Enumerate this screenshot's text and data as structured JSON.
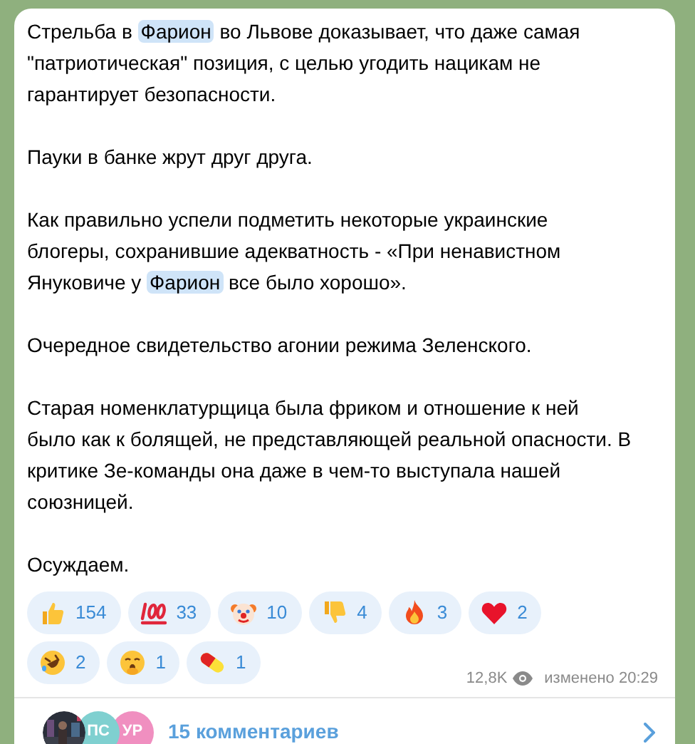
{
  "post": {
    "paragraphs": [
      [
        {
          "text": "Стрельба в ",
          "highlighted": false
        },
        {
          "text": "Фарион",
          "highlighted": true
        },
        {
          "text": " во Львове доказывает, что даже самая \"патриотическая\" позиция, с целью угодить нацикам не гарантирует безопасности.",
          "highlighted": false
        }
      ],
      [
        {
          "text": "Пауки в банке жрут друг друга.",
          "highlighted": false
        }
      ],
      [
        {
          "text": "Как правильно успели подметить некоторые украинские блогеры, сохранившие адекватность - «При ненавистном Януковиче у ",
          "highlighted": false
        },
        {
          "text": "Фарион",
          "highlighted": true
        },
        {
          "text": " все было хорошо».",
          "highlighted": false
        }
      ],
      [
        {
          "text": "Очередное свидетельство агонии режима Зеленского.",
          "highlighted": false
        }
      ],
      [
        {
          "text": "Старая номенклатурщица была фриком и отношение к ней было как к болящей, не представляющей реальной опасности. В критике Зе-команды она даже в чем-то выступала нашей союзницей.",
          "highlighted": false
        }
      ],
      [
        {
          "text": "Осуждаем.",
          "highlighted": false
        }
      ]
    ],
    "reactions": [
      {
        "kind": "thumbs_up",
        "count": "154"
      },
      {
        "kind": "hundred",
        "count": "33"
      },
      {
        "kind": "clown",
        "count": "10"
      },
      {
        "kind": "thumbs_down",
        "count": "4"
      },
      {
        "kind": "fire",
        "count": "3"
      },
      {
        "kind": "heart",
        "count": "2"
      },
      {
        "kind": "rofl",
        "count": "2"
      },
      {
        "kind": "yawn",
        "count": "1"
      },
      {
        "kind": "pill",
        "count": "1"
      }
    ],
    "views": "12,8K",
    "edited": "изменено 20:29",
    "comments": {
      "avatars": [
        {
          "kind": "picture"
        },
        {
          "kind": "initials",
          "text": "ПС",
          "color": "#7fd0d0"
        },
        {
          "kind": "initials",
          "text": "УР",
          "color": "#f08fc0"
        }
      ],
      "label": "15 комментариев"
    }
  }
}
